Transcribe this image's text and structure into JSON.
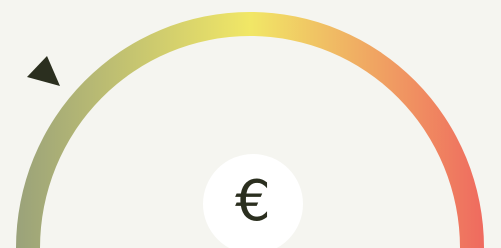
{
  "gauge": {
    "level_percent": 12,
    "colors": {
      "background": "#f5f5f0",
      "gradient_start": "#9aa27a",
      "gradient_mid": "#f1e766",
      "gradient_end": "#ef6a5f",
      "pointer": "#2b2f1f",
      "badge_bg": "#ffffff"
    }
  },
  "badge": {
    "symbol": "€",
    "icon": "euro-icon"
  }
}
